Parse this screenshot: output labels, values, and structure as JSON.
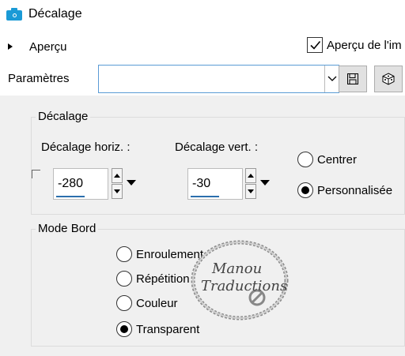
{
  "window": {
    "title": "Décalage",
    "icon": "camera-icon"
  },
  "apercu": {
    "expander_label": "Aperçu",
    "preview_checkbox_label": "Aperçu de l'im",
    "preview_checked": true
  },
  "parametres": {
    "label": "Paramètres",
    "selected_value": "",
    "save_icon": "save-icon",
    "reset_icon": "dice-icon"
  },
  "decalage": {
    "title": "Décalage",
    "horiz_label": "Décalage horiz. :",
    "horiz_value": "-280",
    "vert_label": "Décalage vert. :",
    "vert_value": "-30",
    "options": [
      {
        "label": "Centrer",
        "selected": false
      },
      {
        "label": "Personnalisée",
        "selected": true
      }
    ]
  },
  "mode_bord": {
    "title": "Mode Bord",
    "options": [
      {
        "label": "Enroulement",
        "selected": false
      },
      {
        "label": "Répétition",
        "selected": false
      },
      {
        "label": "Couleur",
        "selected": false
      },
      {
        "label": "Transparent",
        "selected": true
      }
    ]
  },
  "watermark": {
    "line1": "Manou",
    "line2": "Traductions"
  },
  "colors": {
    "accent": "#1a9ad6",
    "focus_border": "#5a9bd5",
    "input_underline": "#2b6fad"
  }
}
